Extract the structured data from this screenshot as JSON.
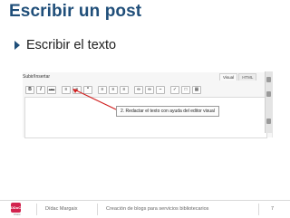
{
  "slide": {
    "title": "Escribir un post",
    "bullet": "Escribir el texto"
  },
  "editor": {
    "upload_label": "Subir/Insertar",
    "tabs": [
      "Visual",
      "HTML"
    ],
    "toolbar_icons": [
      "bold-icon",
      "italic-icon",
      "strikethrough-icon",
      "bullet-list-icon",
      "numbered-list-icon",
      "blockquote-icon",
      "align-left-icon",
      "align-center-icon",
      "align-right-icon",
      "insert-link-icon",
      "unlink-icon",
      "more-tag-icon",
      "spellcheck-icon",
      "fullscreen-icon",
      "kitchen-sink-icon"
    ],
    "toolbar_labels": {
      "bold": "B",
      "italic": "I",
      "strike": "ABC"
    }
  },
  "callout": {
    "text": "2. Redactar el texto con ayuda del editor visual"
  },
  "footer": {
    "logo_text": "DDoC",
    "logo_sub": "D'Arc",
    "author": "Dídac Margaix",
    "course": "Creación de blogs para servicios bibliotecarios",
    "page": "7"
  },
  "colors": {
    "title": "#1f4e79",
    "arrow": "#d02020",
    "logo": "#d2244f"
  }
}
